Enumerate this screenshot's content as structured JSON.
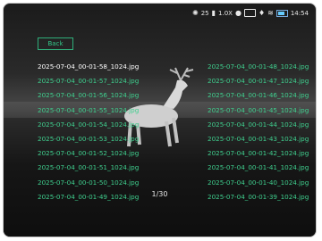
{
  "status_bar": {
    "temperature": "25",
    "zoom": "1.0X",
    "time": "14:54",
    "icons": [
      "settings-icon",
      "thermometer-icon",
      "camera-icon",
      "screen-icon",
      "microphone-icon",
      "wifi-icon",
      "battery-icon"
    ]
  },
  "back_button": {
    "label": "Back"
  },
  "files_left": [
    "2025-07-04_00-01-58_1024.jpg",
    "2025-07-04_00-01-57_1024.jpg",
    "2025-07-04_00-01-56_1024.jpg",
    "2025-07-04_00-01-55_1024.jpg",
    "2025-07-04_00-01-54_1024.jpg",
    "2025-07-04_00-01-53_1024.jpg",
    "2025-07-04_00-01-52_1024.jpg",
    "2025-07-04_00-01-51_1024.jpg",
    "2025-07-04_00-01-50_1024.jpg",
    "2025-07-04_00-01-49_1024.jpg"
  ],
  "files_right": [
    "2025-07-04_00-01-48_1024.jpg",
    "2025-07-04_00-01-47_1024.jpg",
    "2025-07-04_00-01-46_1024.jpg",
    "2025-07-04_00-01-45_1024.jpg",
    "2025-07-04_00-01-44_1024.jpg",
    "2025-07-04_00-01-43_1024.jpg",
    "2025-07-04_00-01-42_1024.jpg",
    "2025-07-04_00-01-41_1024.jpg",
    "2025-07-04_00-01-40_1024.jpg",
    "2025-07-04_00-01-39_1024.jpg"
  ],
  "selected_file": "2025-07-04_00-01-58_1024.jpg",
  "pagination": {
    "label": "1/30"
  },
  "colors": {
    "file_text": "#3fcf8e",
    "selected_text": "#ffffff",
    "accent": "#2fae7a"
  }
}
